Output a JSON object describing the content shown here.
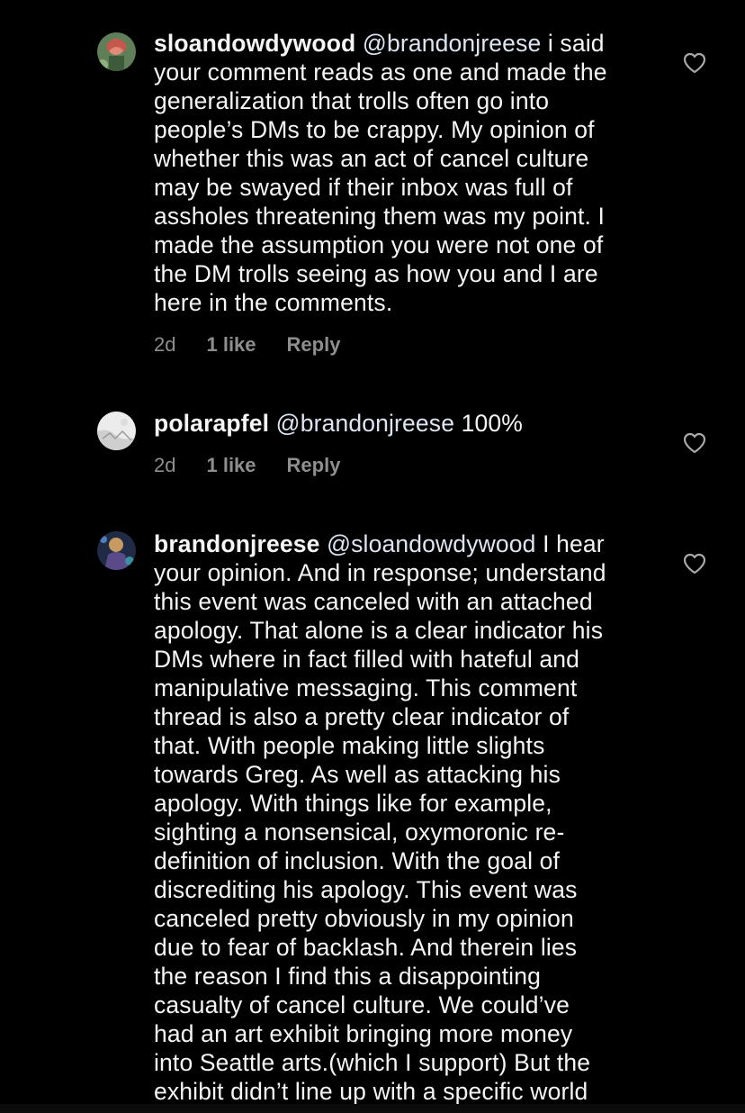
{
  "comments": [
    {
      "username": "sloandowdywood",
      "mention": "@brandonjreese",
      "first_rest": " i said",
      "lines": [
        "your comment reads as one and made the",
        "generalization that trolls often go into",
        "people’s DMs to be crappy. My opinion of",
        "whether this was an act of cancel culture",
        "may be swayed if their inbox was full of",
        "assholes threatening them was my point. I",
        "made the assumption you were not one of",
        "the DM trolls seeing as how you and I are",
        "here in the comments."
      ],
      "time": "2d",
      "likes": "1 like",
      "reply": "Reply",
      "avatar_colors": [
        "#6e8f64",
        "#d97a6a",
        "#3f5a3a"
      ]
    },
    {
      "username": "polarapfel",
      "mention": "@brandonjreese",
      "first_rest": " 100%",
      "lines": [],
      "time": "2d",
      "likes": "1 like",
      "reply": "Reply",
      "avatar_colors": [
        "#e8e8e8",
        "#b9b9b9",
        "#8a8a8a"
      ]
    },
    {
      "username": "brandonjreese",
      "mention": "@sloandowdywood",
      "first_rest": " I hear",
      "lines": [
        "your opinion. And in response; understand",
        "this event was canceled with an attached",
        "apology. That alone is a clear indicator his",
        "DMs where in fact filled with hateful and",
        "manipulative messaging. This comment",
        "thread is also a pretty clear indicator of",
        "that. With people making little slights",
        "towards Greg. As well as attacking his",
        "apology. With things like for example,",
        "sighting a nonsensical, oxymoronic re-",
        "definition of inclusion. With the goal of",
        "discrediting his apology. This event was",
        "canceled pretty obviously in my opinion",
        "due to fear of backlash. And therein lies",
        "the reason I find this a disappointing",
        "casualty of cancel culture. We could’ve",
        "had an art exhibit bringing more money",
        "into Seattle arts.(which I support) But the",
        "exhibit didn’t line up with a specific world"
      ],
      "avatar_colors": [
        "#2b3a5c",
        "#7a5aa8",
        "#c9a45a"
      ]
    }
  ],
  "icons": {
    "like": "heart-outline-icon"
  },
  "colors": {
    "background": "#000000",
    "text": "#f5f5f5",
    "meta": "#8e8e8e"
  }
}
